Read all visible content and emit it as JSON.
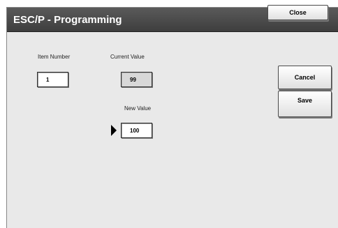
{
  "window": {
    "title": "ESC/P - Programming",
    "close_label": "Close"
  },
  "item_number": {
    "label": "Item Number",
    "value": "1"
  },
  "current_value": {
    "label": "Current Value",
    "value": "99"
  },
  "new_value": {
    "label": "New Value",
    "value": "100"
  },
  "actions": {
    "cancel_label": "Cancel",
    "save_label": "Save"
  },
  "icons": {
    "pointer": "pointer-arrow-icon"
  }
}
